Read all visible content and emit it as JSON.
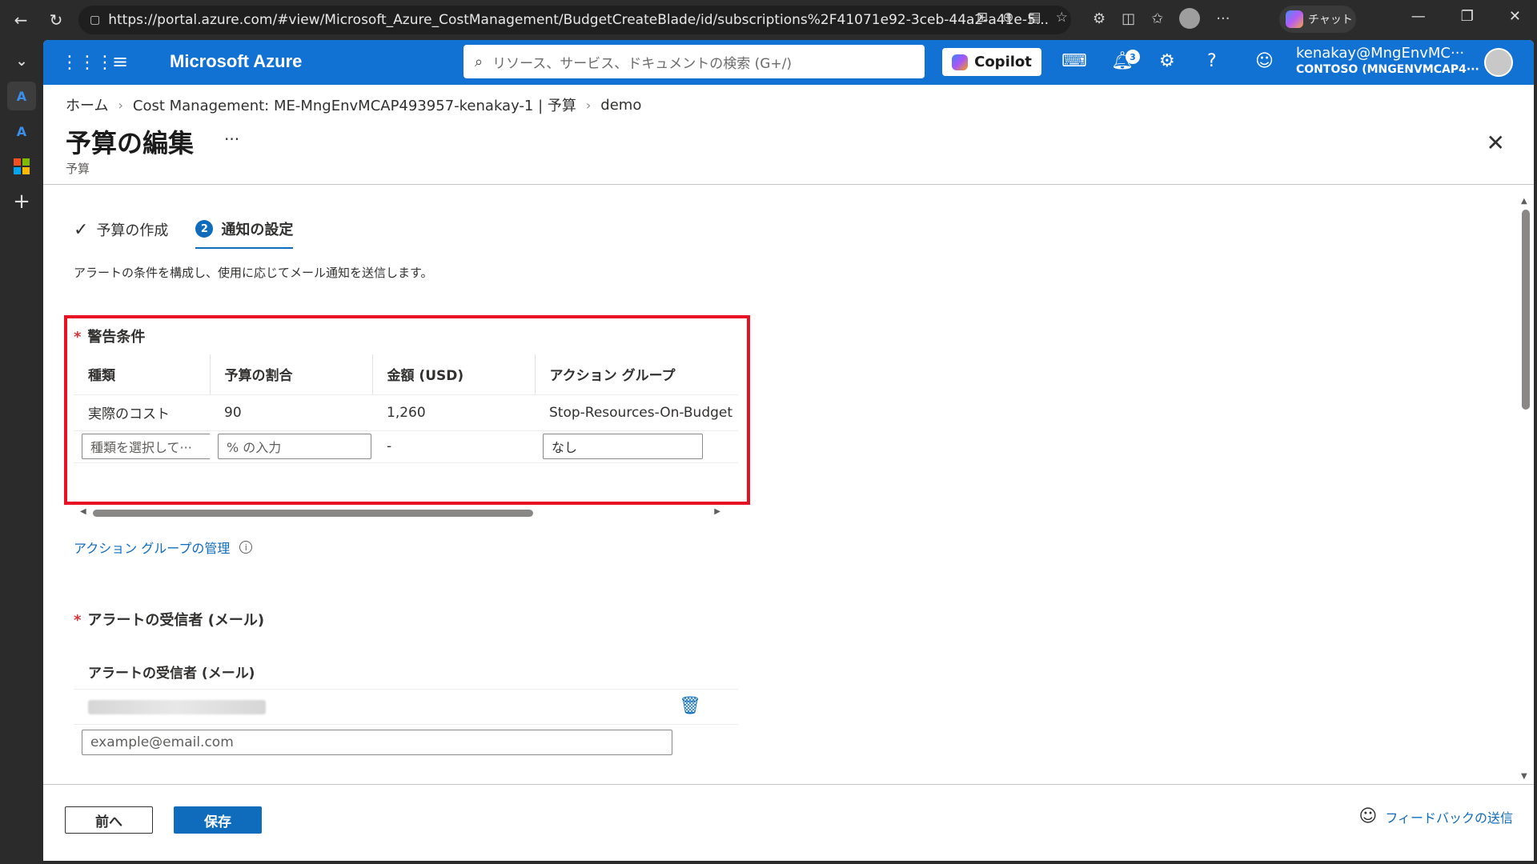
{
  "browser": {
    "url": "https://portal.azure.com/#view/Microsoft_Azure_CostManagement/BudgetCreateBlade/id/subscriptions%2F41071e92-3ceb-44a2-a41e-5...",
    "chat_label": "チャット"
  },
  "topbar": {
    "brand": "Microsoft Azure",
    "search_placeholder": "リソース、サービス、ドキュメントの検索 (G+/)",
    "copilot_label": "Copilot",
    "notification_count": "3",
    "account_user": "kenakay@MngEnvMC···",
    "account_tenant": "CONTOSO (MNGENVMCAP4···"
  },
  "breadcrumb": {
    "home": "ホーム",
    "cost": "Cost Management: ME-MngEnvMCAP493957-kenakay-1 | 予算",
    "demo": "demo"
  },
  "page": {
    "title": "予算の編集",
    "more": "···",
    "subtitle": "予算"
  },
  "tabs": [
    {
      "label": "予算の作成"
    },
    {
      "num": "2",
      "label": "通知の設定"
    }
  ],
  "description": "アラートの条件を構成し、使用に応じてメール通知を送信します。",
  "alert_conditions": {
    "title": "警告条件",
    "required": "*",
    "columns": [
      "種類",
      "予算の割合",
      "金額 (USD)",
      "アクション グループ"
    ],
    "rows": [
      {
        "type": "実際のコスト",
        "percent": "90",
        "amount": "1,260",
        "action_group": "Stop-Resources-On-Budget"
      }
    ],
    "new_row": {
      "type_placeholder": "種類を選択して···",
      "percent_placeholder": "% の入力",
      "amount": "-",
      "action_group": "なし"
    },
    "manage_link": "アクション グループの管理",
    "info": "i"
  },
  "recipients": {
    "title": "アラートの受信者 (メール)",
    "required": "*",
    "column": "アラートの受信者 (メール)",
    "email_placeholder": "example@email.com"
  },
  "footer": {
    "prev_label": "前へ",
    "save_label": "保存",
    "feedback_label": "フィードバックの送信"
  },
  "colors": {
    "azure_blue": "#1272d3",
    "link_blue": "#0f6cbd",
    "highlight_red": "#e81123"
  }
}
